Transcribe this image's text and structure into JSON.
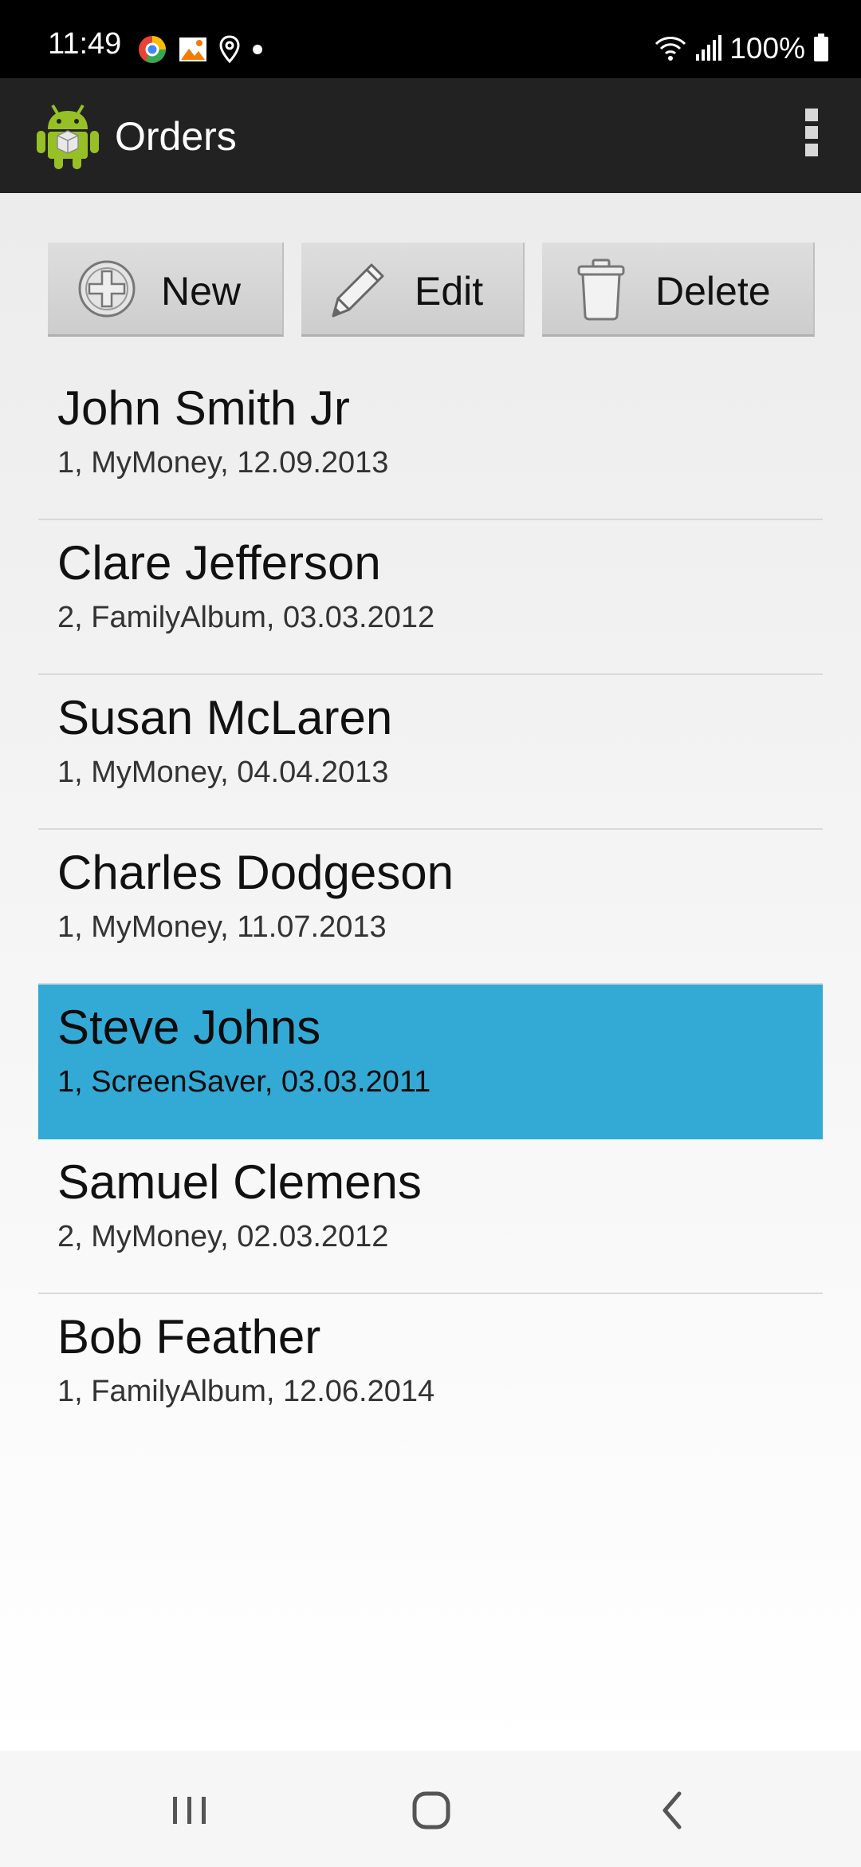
{
  "status_bar": {
    "time": "11:49",
    "battery": "100%",
    "icons_left": [
      "browser-icon",
      "photo-notification-icon",
      "location-icon",
      "dot-icon"
    ],
    "icons_right": [
      "wifi-icon",
      "signal-icon",
      "battery-icon"
    ]
  },
  "action_bar": {
    "title": "Orders",
    "app_icon": "android-icon",
    "overflow_icon": "overflow-menu-icon"
  },
  "toolbar": {
    "new_label": "New",
    "edit_label": "Edit",
    "delete_label": "Delete"
  },
  "orders": [
    {
      "name": "John Smith Jr",
      "detail": "1, MyMoney, 12.09.2013",
      "selected": false
    },
    {
      "name": "Clare Jefferson",
      "detail": "2, FamilyAlbum, 03.03.2012",
      "selected": false
    },
    {
      "name": "Susan McLaren",
      "detail": "1, MyMoney, 04.04.2013",
      "selected": false
    },
    {
      "name": "Charles Dodgeson",
      "detail": "1, MyMoney, 11.07.2013",
      "selected": false
    },
    {
      "name": "Steve Johns",
      "detail": "1, ScreenSaver, 03.03.2011",
      "selected": true
    },
    {
      "name": "Samuel Clemens",
      "detail": "2, MyMoney, 02.03.2012",
      "selected": false
    },
    {
      "name": "Bob Feather",
      "detail": "1, FamilyAlbum, 12.06.2014",
      "selected": false
    }
  ],
  "colors": {
    "selected": "#33aad6",
    "action_bar": "#222222",
    "status_bar": "#000000"
  },
  "nav_bar": {
    "buttons": [
      "recent-apps-icon",
      "home-icon",
      "back-icon"
    ]
  }
}
